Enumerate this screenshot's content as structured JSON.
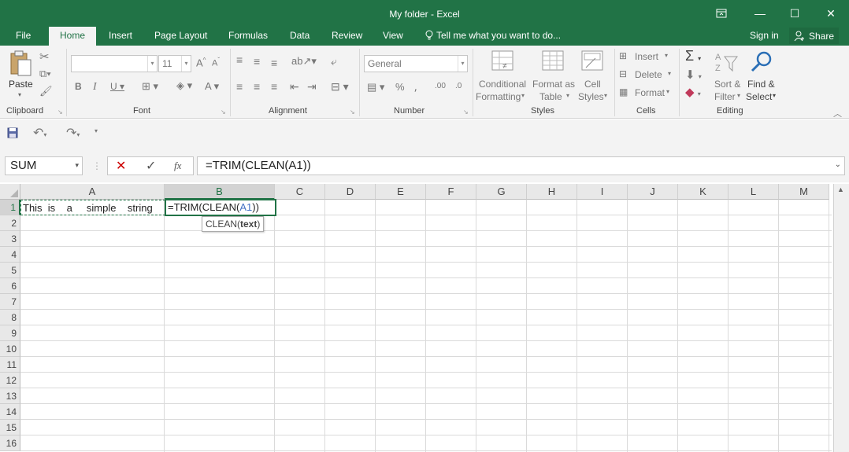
{
  "window": {
    "title": "My folder - Excel",
    "restore_icon": "ribbon-display-icon",
    "minimize_glyph": "—",
    "maximize_glyph": "☐",
    "close_glyph": "✕"
  },
  "tabs": [
    "File",
    "Home",
    "Insert",
    "Page Layout",
    "Formulas",
    "Data",
    "Review",
    "View"
  ],
  "active_tab": "Home",
  "tell_me": "Tell me what you want to do...",
  "sign_in": "Sign in",
  "share": "Share",
  "ribbon": {
    "clipboard": {
      "label": "Clipboard",
      "paste": "Paste"
    },
    "font": {
      "label": "Font",
      "font_name": "",
      "font_size": "11"
    },
    "alignment": {
      "label": "Alignment"
    },
    "number": {
      "label": "Number",
      "format": "General"
    },
    "styles": {
      "label": "Styles",
      "conditional_formatting": [
        "Conditional",
        "Formatting"
      ],
      "format_as_table": [
        "Format as",
        "Table"
      ],
      "cell_styles": [
        "Cell",
        "Styles"
      ]
    },
    "cells": {
      "label": "Cells",
      "insert": "Insert",
      "delete": "Delete",
      "format": "Format"
    },
    "editing": {
      "label": "Editing",
      "sort_filter": [
        "Sort &",
        "Filter"
      ],
      "find_select": [
        "Find &",
        "Select"
      ]
    }
  },
  "formula_bar": {
    "name_box": "SUM",
    "formula": "=TRIM(CLEAN(A1))"
  },
  "columns": [
    "A",
    "B",
    "C",
    "D",
    "E",
    "F",
    "G",
    "H",
    "I",
    "J",
    "K",
    "L",
    "M"
  ],
  "rows": [
    "1",
    "2",
    "3",
    "4",
    "5",
    "6",
    "7",
    "8",
    "9",
    "10",
    "11",
    "12",
    "13",
    "14",
    "15",
    "16"
  ],
  "selected_column": "B",
  "selected_row": "1",
  "cells": {
    "A1": "This  is    a     simple    string",
    "B1_prefix": "=TRIM(CLEAN(",
    "B1_ref": "A1",
    "B1_suffix": "))"
  },
  "tooltip": {
    "func": "CLEAN(",
    "arg": "text",
    "close": ")"
  },
  "colors": {
    "accent": "#217346",
    "ref_highlight": "#4472c4"
  }
}
